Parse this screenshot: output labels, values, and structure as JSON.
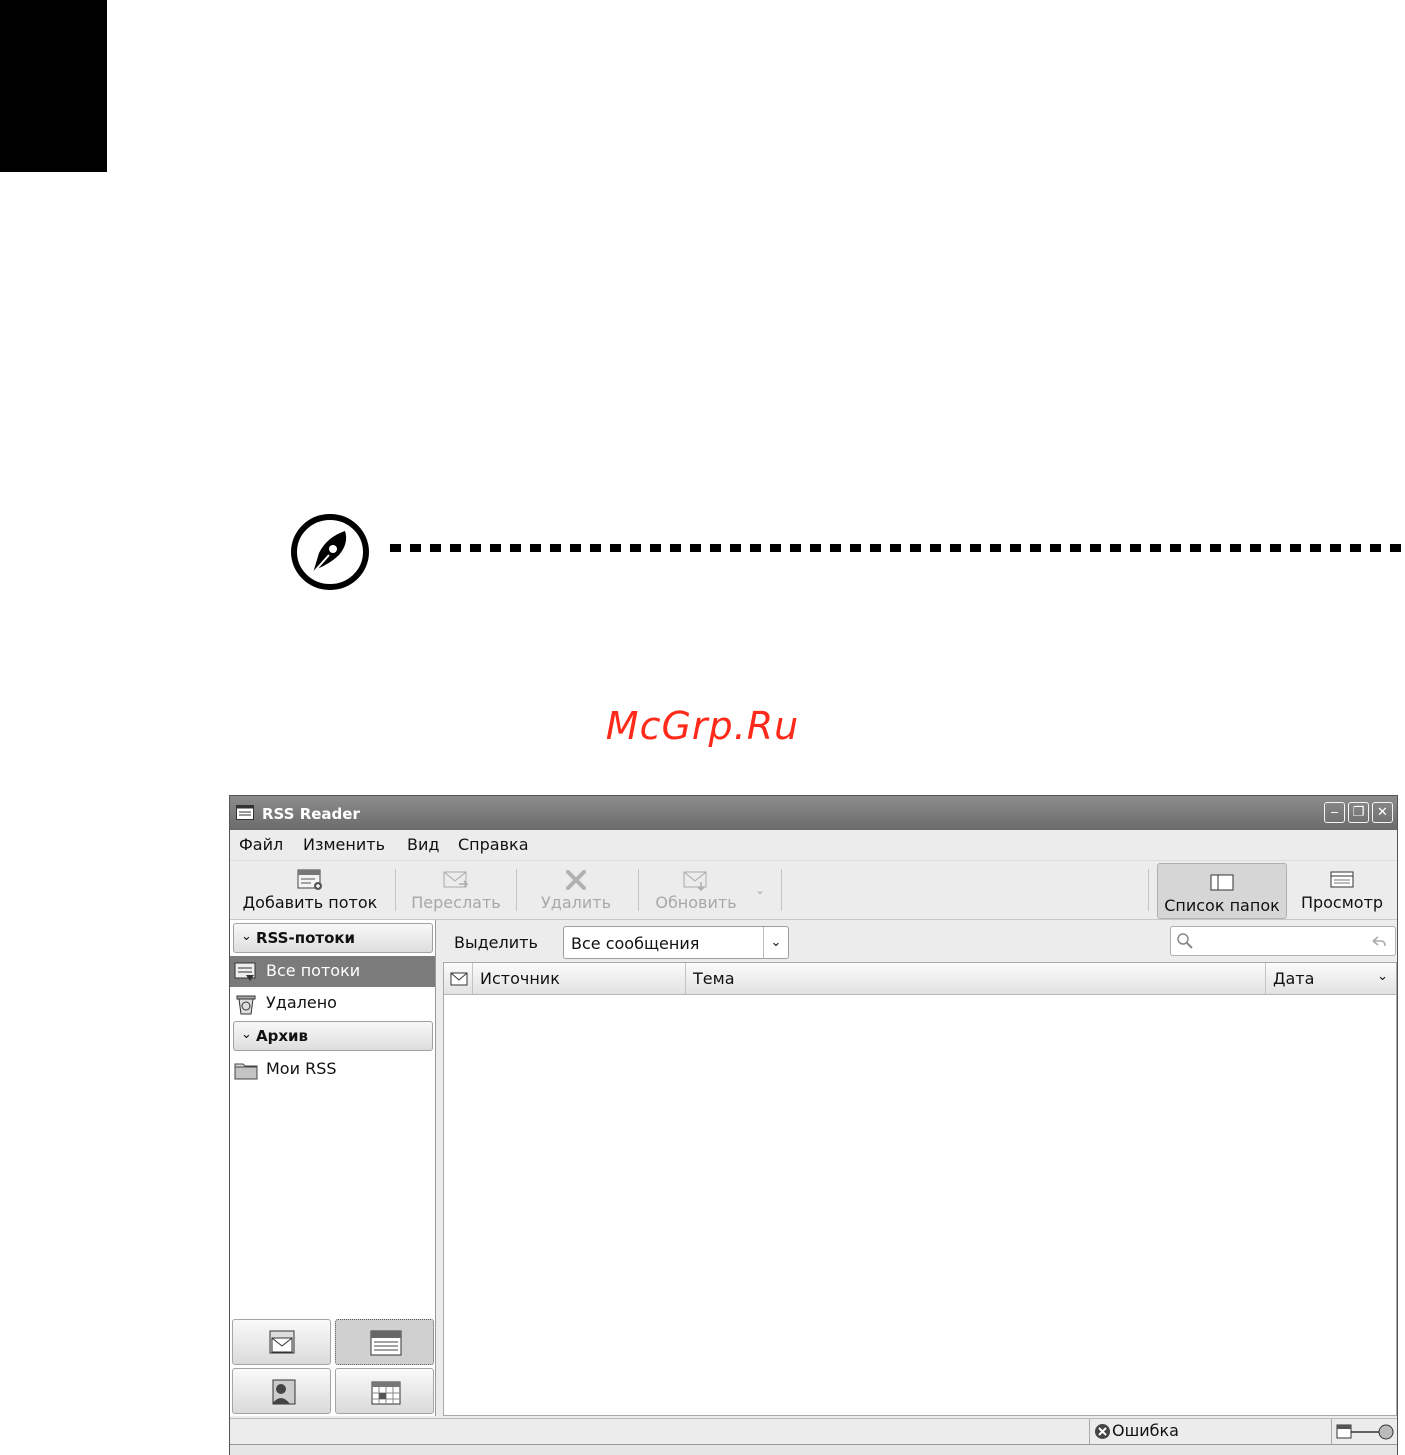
{
  "watermark": "McGrp.Ru",
  "window": {
    "title": "RSS Reader",
    "controls": {
      "minimize": "‒",
      "restore": "❐",
      "close": "✕"
    }
  },
  "menu": [
    "Файл",
    "Изменить",
    "Вид",
    "Справка"
  ],
  "toolbar": {
    "add_feed": "Добавить поток",
    "forward": "Переслать",
    "delete": "Удалить",
    "refresh": "Обновить",
    "folder_list": "Список папок",
    "view": "Просмотр"
  },
  "sidebar": {
    "group_feeds": "RSS-потоки",
    "all_feeds": "Все потоки",
    "deleted": "Удалено",
    "group_archive": "Архив",
    "my_rss": "Мои RSS"
  },
  "filter": {
    "label": "Выделить",
    "selected": "Все сообщения",
    "search_placeholder": ""
  },
  "columns": {
    "source": "Источник",
    "subject": "Тема",
    "date": "Дата"
  },
  "status": {
    "error": "Ошибка"
  }
}
